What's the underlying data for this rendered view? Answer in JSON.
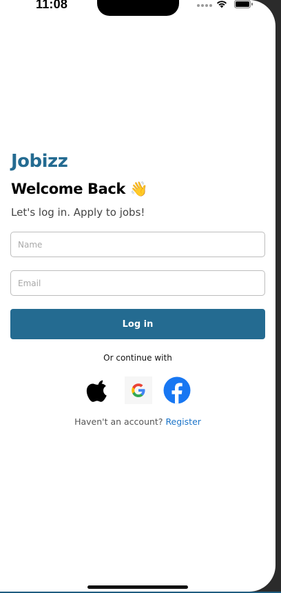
{
  "status_bar": {
    "time": "11:08"
  },
  "brand": {
    "name": "Jobizz",
    "color": "#246b91"
  },
  "header": {
    "title": "Welcome Back 👋",
    "subtitle": "Let's log in. Apply to jobs!"
  },
  "form": {
    "name_placeholder": "Name",
    "name_value": "",
    "email_placeholder": "Email",
    "email_value": "",
    "login_label": "Log in"
  },
  "social": {
    "continue_text": "Or continue with",
    "providers": [
      {
        "name": "Apple",
        "icon": "apple-icon"
      },
      {
        "name": "Google",
        "icon": "google-icon"
      },
      {
        "name": "Facebook",
        "icon": "facebook-icon"
      }
    ]
  },
  "footer": {
    "prompt": "Haven't an account?",
    "register_label": "Register",
    "link_color": "#1a73c8"
  }
}
